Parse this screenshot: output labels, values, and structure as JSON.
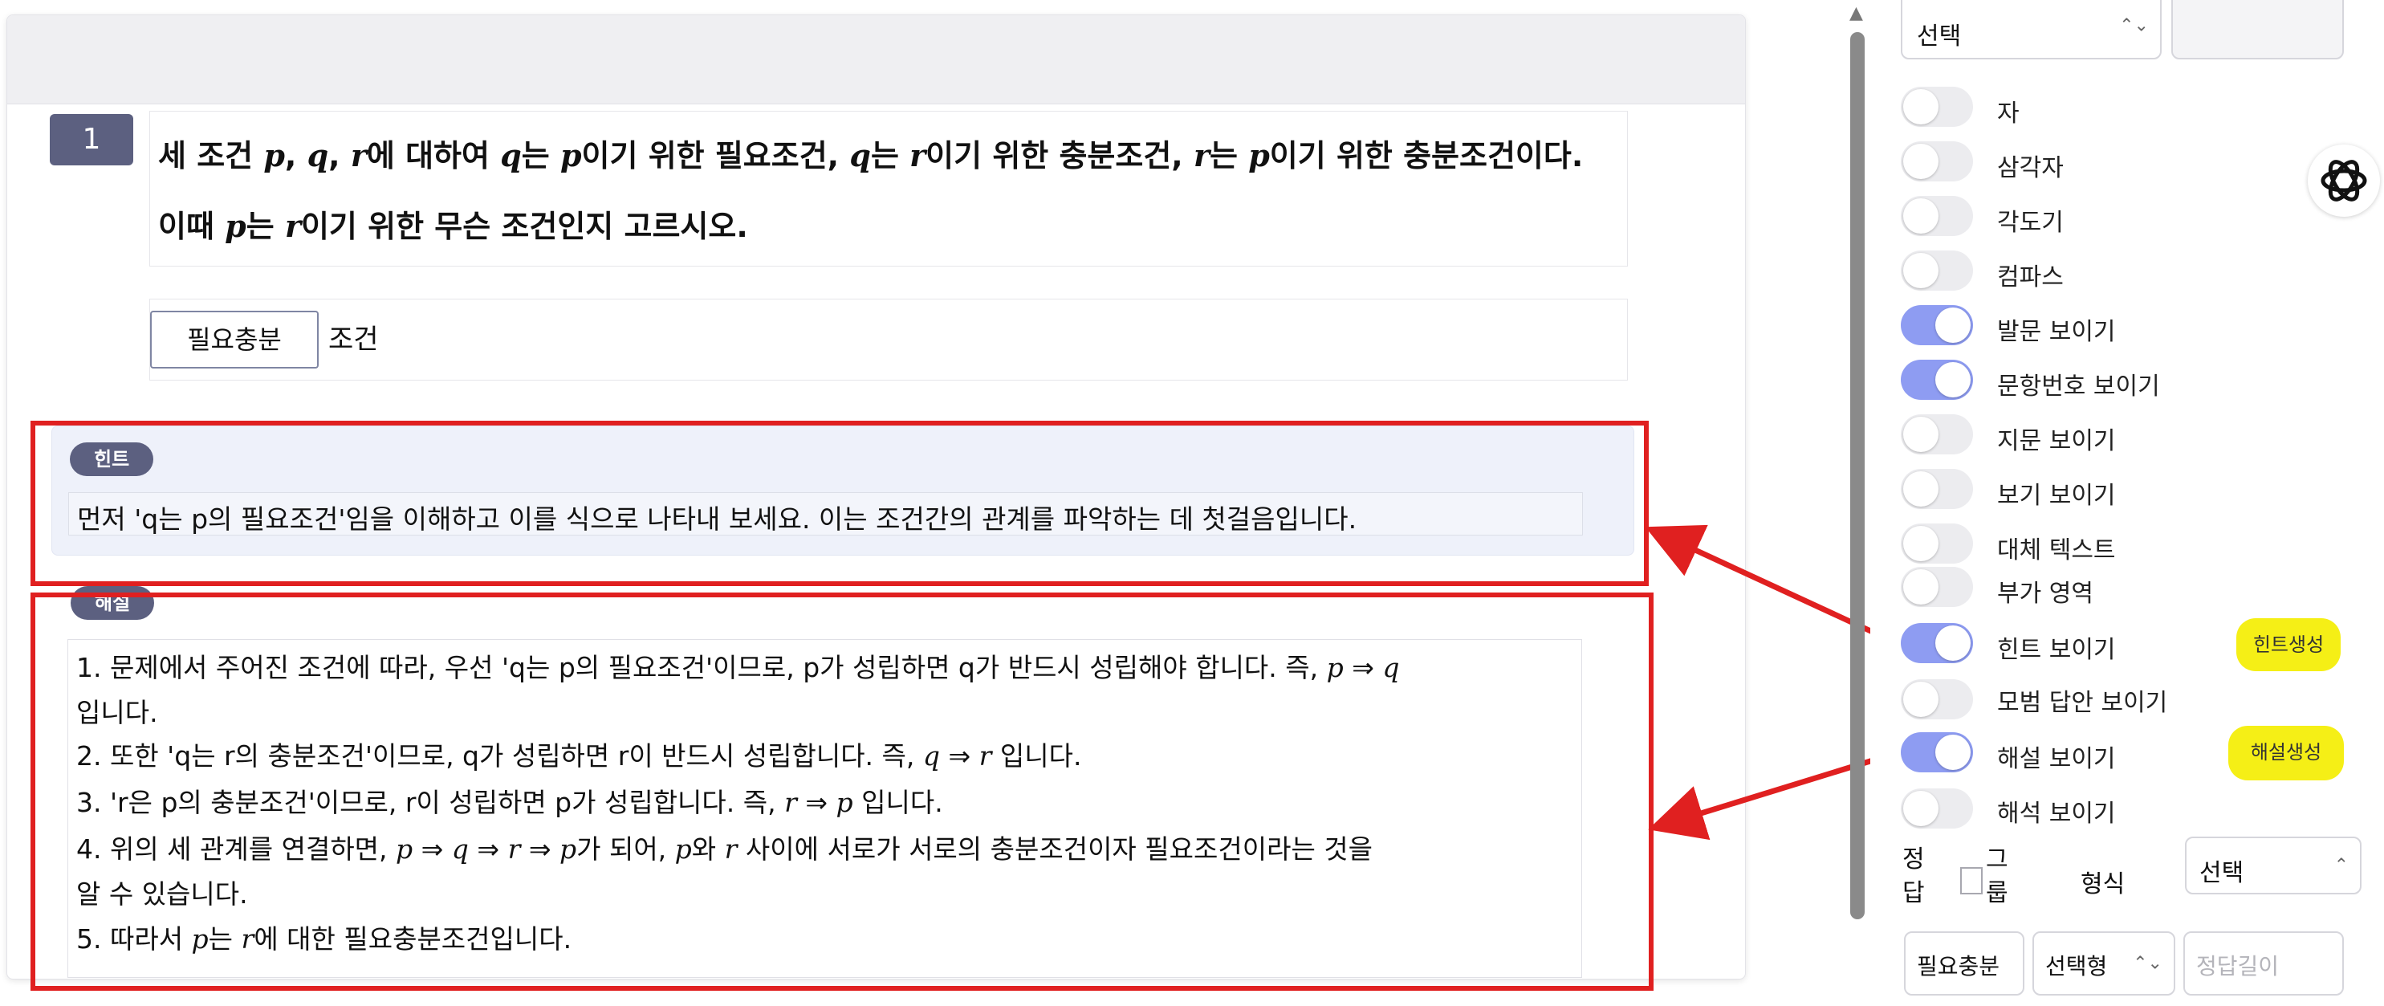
{
  "question": {
    "number": "1",
    "line1": {
      "s1": "세 조건 ",
      "p1": "p",
      "s2": ", ",
      "q1": "q",
      "s3": ", ",
      "r1": "r",
      "s4": "에 대하여 ",
      "q2": "q",
      "s5": "는 ",
      "p2": "p",
      "s6": "이기 위한 필요조건, ",
      "q3": "q",
      "s7": "는 ",
      "r2": "r",
      "s8": "이기 위한 충분조건, ",
      "r3": "r",
      "s9": "는 ",
      "p3": "p",
      "s10": "이기 위한 충분조건이다."
    },
    "line2": {
      "s1": "이때 ",
      "p1": "p",
      "s2": "는 ",
      "r1": "r",
      "s3": "이기 위한 무슨 조건인지 고르시오."
    }
  },
  "answer": {
    "value": "필요충분",
    "suffix": "조건"
  },
  "hint": {
    "badge": "힌트",
    "text": "먼저 'q는 p의 필요조건'임을 이해하고 이를 식으로 나타내 보세요. 이는 조건간의 관계를 파악하는 데 첫걸음입니다."
  },
  "solution": {
    "badge": "해설",
    "line1": {
      "text": "1. 문제에서 주어진 조건에 따라, 우선 'q는 p의 필요조건'이므로, p가 성립하면 q가 반드시 성립해야 합니다. 즉, ",
      "m1": "p",
      "op": " ⇒ ",
      "m2": "q"
    },
    "line1b": "입니다.",
    "line2": {
      "text": "2. 또한 'q는 r의 충분조건'이므로, q가 성립하면 r이 반드시 성립합니다. 즉, ",
      "m1": "q",
      "op": " ⇒ ",
      "m2": "r",
      "end": "  입니다."
    },
    "line3": {
      "text": "3. 'r은 p의 충분조건'이므로, r이 성립하면 p가 성립합니다. 즉, ",
      "m1": "r",
      "op": " ⇒ ",
      "m2": "p",
      "end": "  입니다."
    },
    "line4": {
      "text": "4. 위의 세 관계를 연결하면, ",
      "m1": "p",
      "op1": " ⇒ ",
      "m2": "q",
      "op2": " ⇒ ",
      "m3": "r",
      "op3": " ⇒ ",
      "m4": "p",
      "t2": "가 되어, ",
      "m5": "p",
      "t3": "와 ",
      "m6": "r",
      "t4": " 사이에 서로가 서로의 충분조건이자 필요조건이라는 것을"
    },
    "line4b": "알 수 있습니다.",
    "line5": {
      "text": "5. 따라서 ",
      "m1": "p",
      "t2": "는 ",
      "m2": "r",
      "t3": "에 대한 필요충분조건입니다."
    }
  },
  "settings": {
    "top_select": {
      "value": "선택"
    },
    "toggles": [
      {
        "label": "자",
        "on": false
      },
      {
        "label": "삼각자",
        "on": false
      },
      {
        "label": "각도기",
        "on": false
      },
      {
        "label": "컴파스",
        "on": false
      },
      {
        "label": "발문 보이기",
        "on": true
      },
      {
        "label": "문항번호 보이기",
        "on": true
      },
      {
        "label": "지문 보이기",
        "on": false
      },
      {
        "label": "보기 보이기",
        "on": false
      },
      {
        "label": "대체 텍스트",
        "on": false
      },
      {
        "label": "부가 영역",
        "on": false
      },
      {
        "label": "힌트 보이기",
        "on": true
      },
      {
        "label": "모범 답안 보이기",
        "on": false
      },
      {
        "label": "해설 보이기",
        "on": true
      },
      {
        "label": "해석 보이기",
        "on": false
      }
    ],
    "hint_generate": "힌트생성",
    "solution_generate": "해설생성",
    "answer_label": "정답",
    "group_label": "그룹",
    "format_label": "형식",
    "format_select": "선택",
    "answer_value": "필요충분",
    "type_select": "선택형",
    "length_placeholder": "정답길이"
  },
  "colors": {
    "annotation": "#e02020",
    "highlight": "#f5ef16",
    "toggle_on": "#8e9cf2",
    "badge": "#5c6080"
  }
}
